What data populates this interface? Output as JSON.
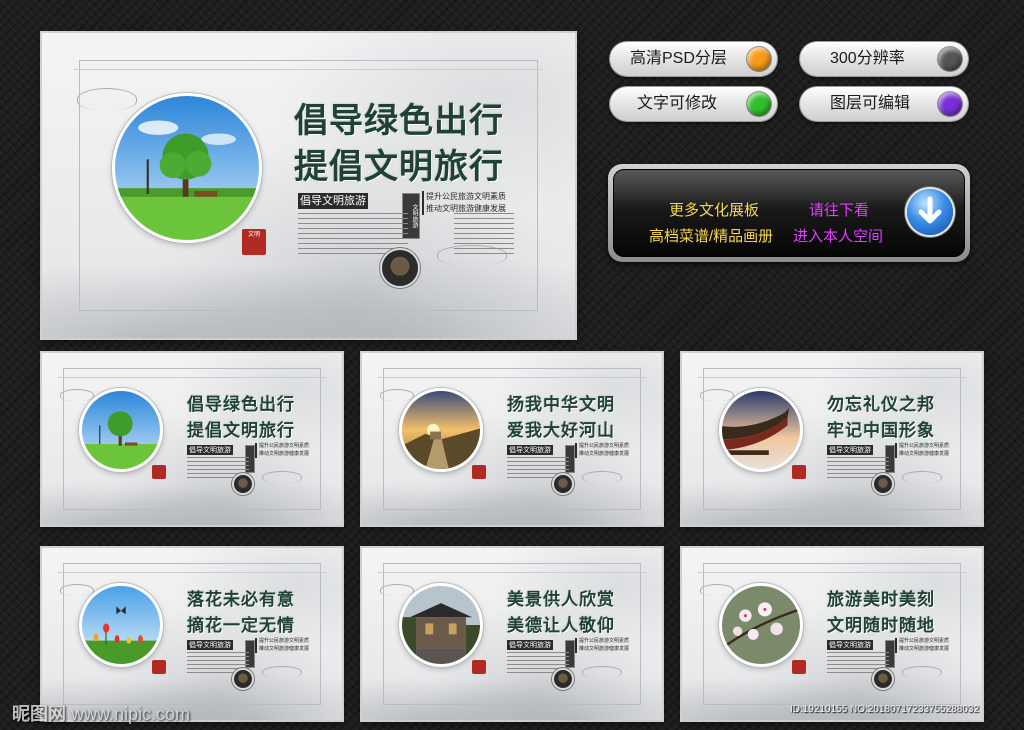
{
  "hero": {
    "title1": "倡导绿色出行",
    "title2": "提倡文明旅行",
    "sub": "倡导文明旅游",
    "slogan1": "提升公民旅游文明素质",
    "slogan2": "推动文明旅游健康发展",
    "badge": "文明旅游",
    "seal": "文明"
  },
  "boards": [
    {
      "title1": "倡导绿色出行",
      "title2": "提倡文明旅行",
      "sub": "倡导文明旅游",
      "scene": "tree-icon"
    },
    {
      "title1": "扬我中华文明",
      "title2": "爱我大好河山",
      "sub": "倡导文明旅游",
      "scene": "great-wall-icon"
    },
    {
      "title1": "勿忘礼仪之邦",
      "title2": "牢记中国形象",
      "sub": "倡导文明旅游",
      "scene": "temple-roof-icon"
    },
    {
      "title1": "落花未必有意",
      "title2": "摘花一定无情",
      "sub": "倡导文明旅游",
      "scene": "tulip-butterfly-icon"
    },
    {
      "title1": "美景供人欣赏",
      "title2": "美德让人敬仰",
      "sub": "倡导文明旅游",
      "scene": "ancient-town-icon"
    },
    {
      "title1": "旅游美时美刻",
      "title2": "文明随时随地",
      "sub": "倡导文明旅游",
      "scene": "plum-blossom-icon"
    }
  ],
  "pills": [
    {
      "label": "高清PSD分层",
      "color": "#f59a1c"
    },
    {
      "label": "300分辨率",
      "color": "#555555"
    },
    {
      "label": "文字可修改",
      "color": "#2fbf2a"
    },
    {
      "label": "图层可编辑",
      "color": "#7a2fd6"
    }
  ],
  "promo": {
    "line1_left": "更多文化展板",
    "line2_left": "高档菜谱/精品画册",
    "line1_right": "请往下看",
    "line2_right": "进入本人空间",
    "icon": "down-arrow-icon"
  },
  "watermark": {
    "logo": "昵图网",
    "url": "www.nipic.com"
  },
  "id_text": "ID:19210155 NO:20180717233755288032"
}
